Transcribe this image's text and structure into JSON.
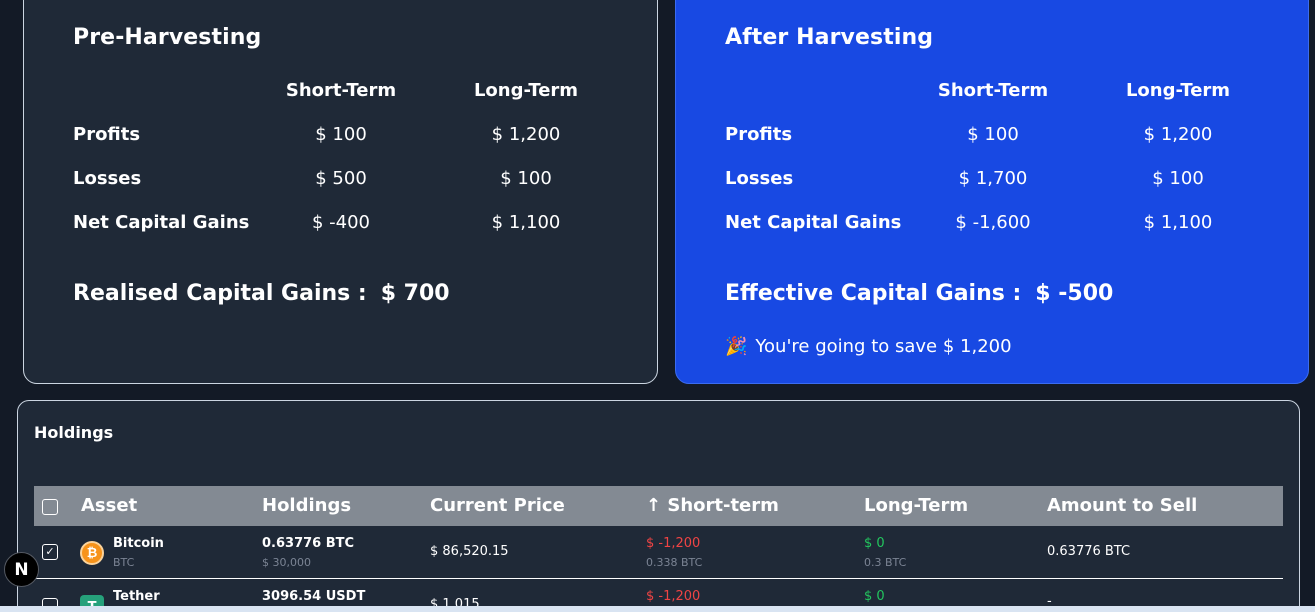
{
  "pre_harvesting": {
    "title": "Pre-Harvesting",
    "col_short": "Short-Term",
    "col_long": "Long-Term",
    "rows": [
      {
        "label": "Profits",
        "short": "$ 100",
        "long": "$ 1,200"
      },
      {
        "label": "Losses",
        "short": "$ 500",
        "long": "$ 100"
      },
      {
        "label": "Net Capital Gains",
        "short": "$ -400",
        "long": "$ 1,100"
      }
    ],
    "gains_label": "Realised Capital Gains :",
    "gains_value": "$ 700"
  },
  "after_harvesting": {
    "title": "After Harvesting",
    "col_short": "Short-Term",
    "col_long": "Long-Term",
    "rows": [
      {
        "label": "Profits",
        "short": "$ 100",
        "long": "$ 1,200"
      },
      {
        "label": "Losses",
        "short": "$ 1,700",
        "long": "$ 100"
      },
      {
        "label": "Net Capital Gains",
        "short": "$ -1,600",
        "long": "$ 1,100"
      }
    ],
    "gains_label": "Effective Capital Gains :",
    "gains_value": "$ -500",
    "savings_emoji": "🎉",
    "savings_text": "You're going to save $ 1,200"
  },
  "holdings": {
    "title": "Holdings",
    "columns": {
      "asset": "Asset",
      "holdings": "Holdings",
      "current_price": "Current Price",
      "short_term": "↑ Short-term",
      "long_term": "Long-Term",
      "amount_to_sell": "Amount to Sell"
    },
    "rows": [
      {
        "checked": "✓",
        "coin_glyph": "₿",
        "name": "Bitcoin",
        "symbol": "BTC",
        "holdings": "0.63776 BTC",
        "avg_price": "$ 30,000",
        "current_price": "$ 86,520.15",
        "short_term": "$ -1,200",
        "short_term_qty": "0.338 BTC",
        "long_term": "$ 0",
        "long_term_qty": "0.3 BTC",
        "amount_to_sell": "0.63776 BTC"
      },
      {
        "checked": "",
        "coin_glyph": "T",
        "name": "Tether",
        "symbol": "",
        "holdings": "3096.54 USDT",
        "avg_price": "",
        "current_price": "$ 1.015",
        "short_term": "$ -1,200",
        "short_term_qty": "",
        "long_term": "$ 0",
        "long_term_qty": "",
        "amount_to_sell": "-"
      }
    ]
  },
  "badge": "N"
}
